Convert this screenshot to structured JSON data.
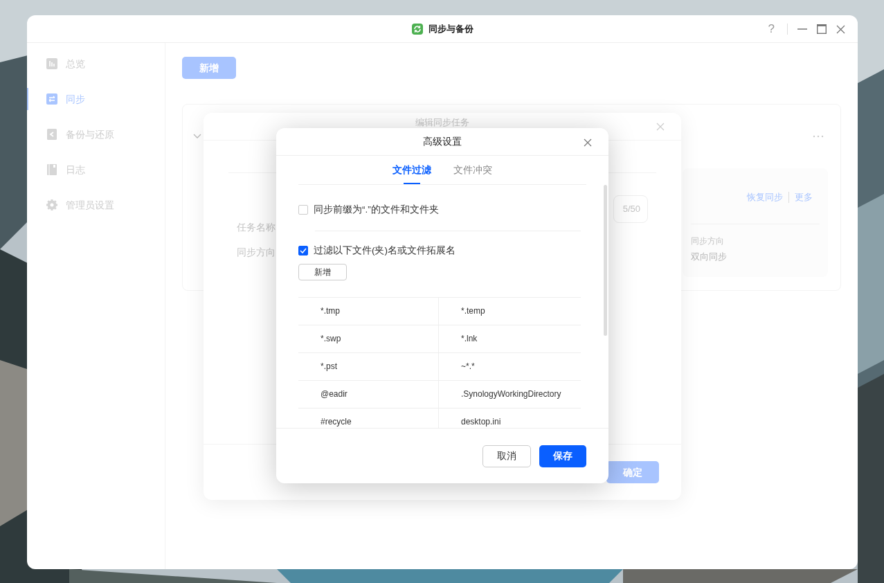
{
  "window": {
    "title": "同步与备份",
    "help": "?"
  },
  "sidebar": {
    "items": [
      {
        "label": "总览",
        "selected": false
      },
      {
        "label": "同步",
        "selected": true
      },
      {
        "label": "备份与还原",
        "selected": false
      },
      {
        "label": "日志",
        "selected": false
      },
      {
        "label": "管理员设置",
        "selected": false
      }
    ]
  },
  "toolbar": {
    "add_button": "新增"
  },
  "task_card": {
    "actions": [
      "恢复同步",
      "更多"
    ],
    "fields": [
      {
        "label": "同步方向",
        "value": "双向同步"
      }
    ]
  },
  "edit_dialog": {
    "title": "编辑同步任务",
    "fields": [
      {
        "label": "任务名称",
        "counter": "5/50"
      },
      {
        "label": "同步方向"
      }
    ],
    "confirm_button": "确定"
  },
  "advanced_dialog": {
    "title": "高级设置",
    "tabs": [
      {
        "label": "文件过滤",
        "selected": true
      },
      {
        "label": "文件冲突",
        "selected": false
      }
    ],
    "options": [
      {
        "label": "同步前缀为“.”的文件和文件夹",
        "checked": false
      },
      {
        "label": "过滤以下文件(夹)名或文件拓展名",
        "checked": true
      }
    ],
    "add_button": "新增",
    "filters": [
      [
        "*.tmp",
        "*.temp"
      ],
      [
        "*.swp",
        "*.lnk"
      ],
      [
        "*.pst",
        "~*.*"
      ],
      [
        "@eadir",
        ".SynologyWorkingDirectory"
      ],
      [
        "#recycle",
        "desktop.ini"
      ]
    ],
    "cancel_button": "取消",
    "save_button": "保存"
  }
}
